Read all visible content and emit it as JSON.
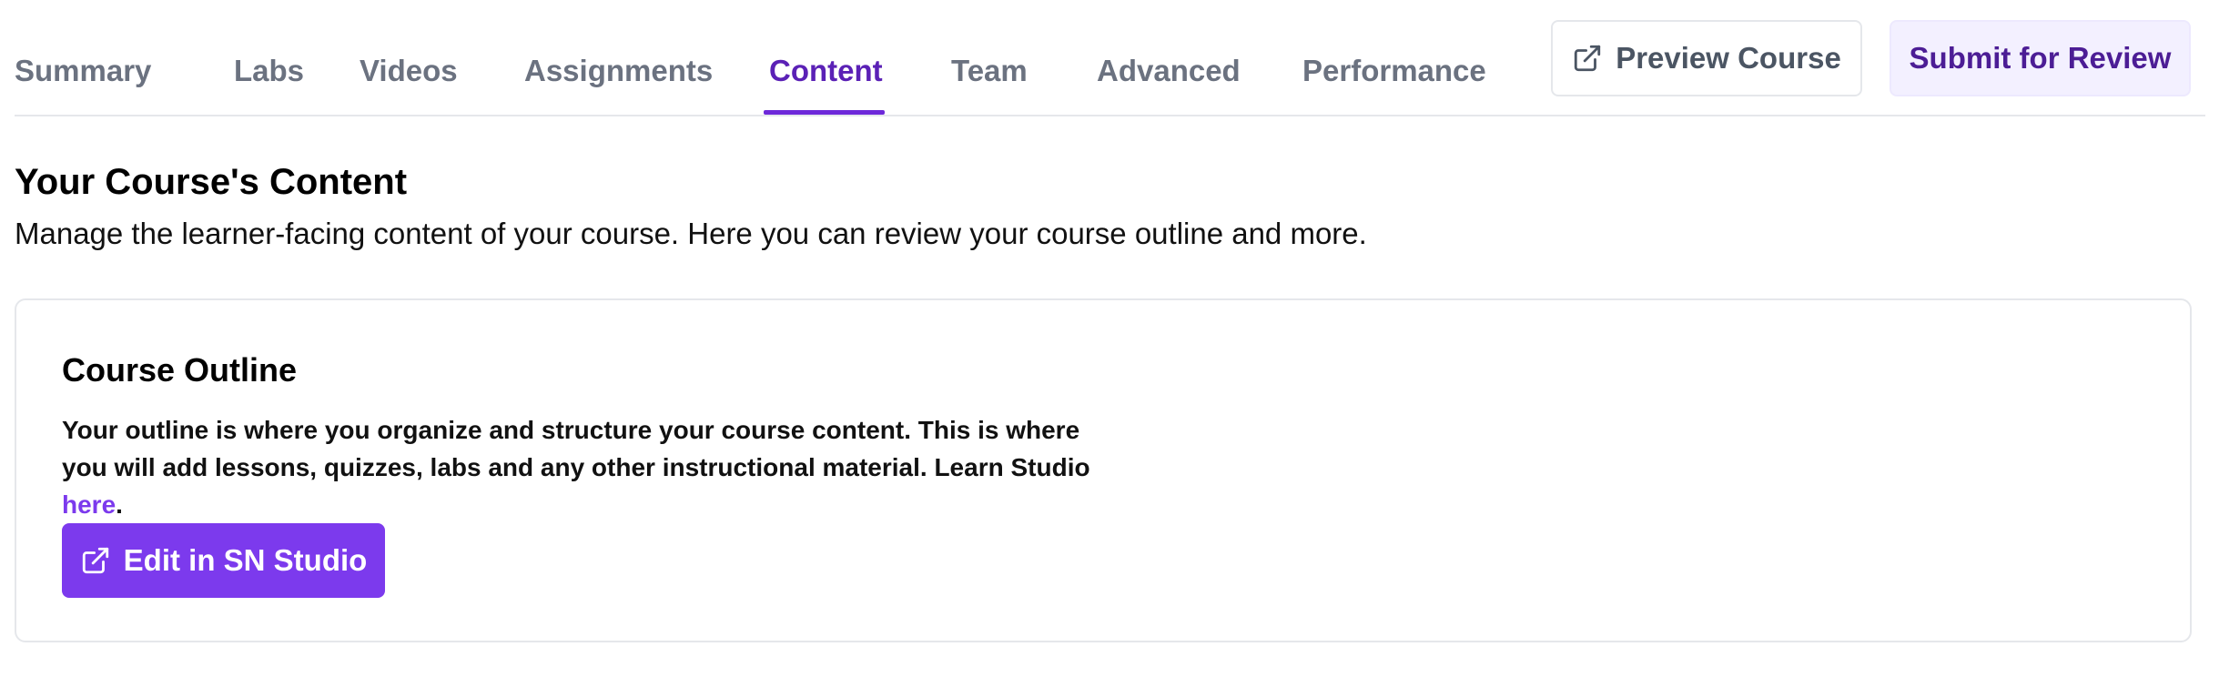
{
  "tabs": [
    {
      "label": "Summary",
      "active": false
    },
    {
      "label": "Labs",
      "active": false
    },
    {
      "label": "Videos",
      "active": false
    },
    {
      "label": "Assignments",
      "active": false
    },
    {
      "label": "Content",
      "active": true
    },
    {
      "label": "Team",
      "active": false
    },
    {
      "label": "Advanced",
      "active": false
    },
    {
      "label": "Performance",
      "active": false
    }
  ],
  "header_actions": {
    "preview_label": "Preview Course",
    "preview_icon": "external-link-icon",
    "submit_label": "Submit for Review"
  },
  "page": {
    "title": "Your Course's Content",
    "subtitle": "Manage the learner-facing content of your course. Here you can review your course outline and more."
  },
  "outline_card": {
    "title": "Course Outline",
    "body": "Your outline is where you organize and structure your course content. This is where you will add lessons, quizzes, labs and any other instructional material. Learn Studio",
    "link_text": "here",
    "trailing": ".",
    "button_label": "Edit in SN Studio",
    "button_icon": "external-link-icon"
  },
  "colors": {
    "accent": "#7c3aed",
    "active_tab": "#5b21b6",
    "inactive_tab": "#6b7280",
    "submit_bg": "#f3f0ff"
  }
}
